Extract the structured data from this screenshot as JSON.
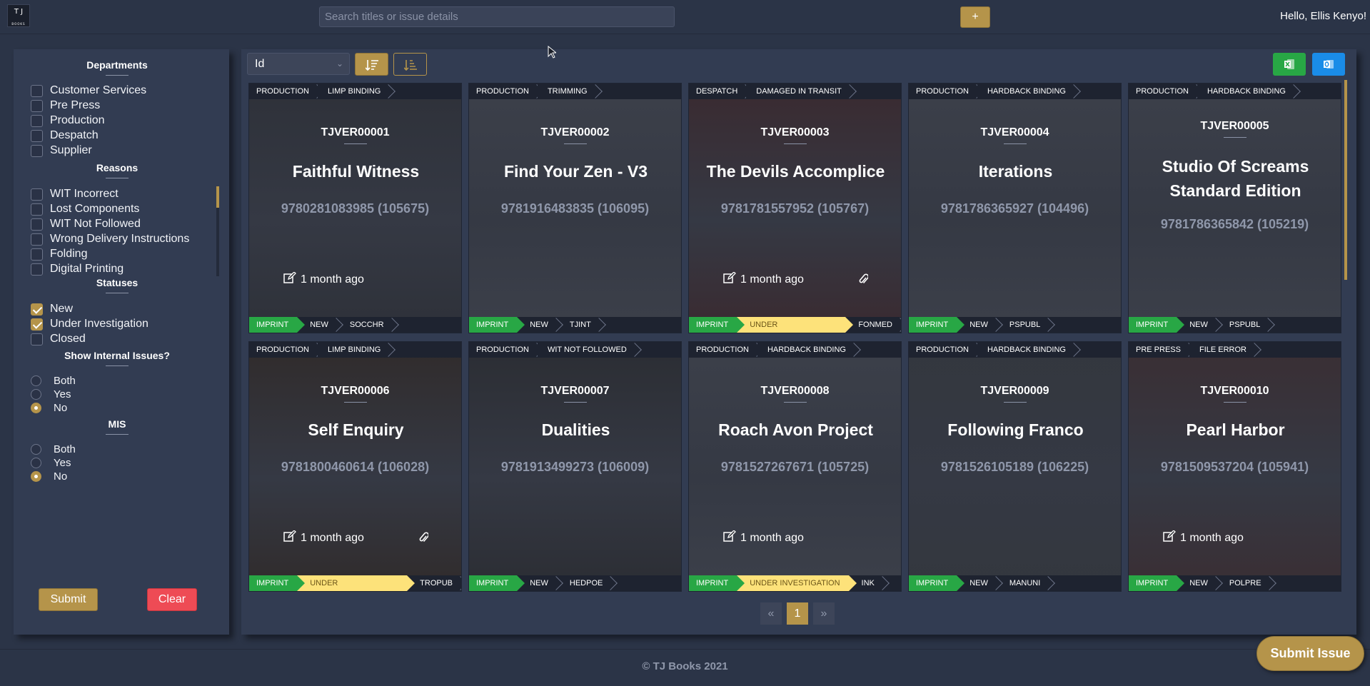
{
  "header": {
    "logo_line1": "T J",
    "logo_line2": "BOOKS",
    "search_placeholder": "Search titles or issue details",
    "add_label": "+",
    "greeting": "Hello, Ellis Kenyo!"
  },
  "filters": {
    "departments_title": "Departments",
    "departments": [
      {
        "label": "Customer Services",
        "checked": false
      },
      {
        "label": "Pre Press",
        "checked": false
      },
      {
        "label": "Production",
        "checked": false
      },
      {
        "label": "Despatch",
        "checked": false
      },
      {
        "label": "Supplier",
        "checked": false
      }
    ],
    "reasons_title": "Reasons",
    "reasons": [
      {
        "label": "WIT Incorrect",
        "checked": false
      },
      {
        "label": "Lost Components",
        "checked": false
      },
      {
        "label": "WIT Not Followed",
        "checked": false
      },
      {
        "label": "Wrong Delivery Instructions",
        "checked": false
      },
      {
        "label": "Folding",
        "checked": false
      },
      {
        "label": "Digital Printing",
        "checked": false
      }
    ],
    "statuses_title": "Statuses",
    "statuses": [
      {
        "label": "New",
        "checked": true
      },
      {
        "label": "Under Investigation",
        "checked": true
      },
      {
        "label": "Closed",
        "checked": false
      }
    ],
    "internal_title": "Show Internal Issues?",
    "internal_options": [
      {
        "label": "Both",
        "selected": false
      },
      {
        "label": "Yes",
        "selected": false
      },
      {
        "label": "No",
        "selected": true
      }
    ],
    "mis_title": "MIS",
    "mis_options": [
      {
        "label": "Both",
        "selected": false
      },
      {
        "label": "Yes",
        "selected": false
      },
      {
        "label": "No",
        "selected": true
      }
    ],
    "submit_label": "Submit",
    "clear_label": "Clear"
  },
  "toolbar": {
    "sort_field": "Id",
    "sort_ascending": true
  },
  "issues": [
    {
      "dept": "PRODUCTION",
      "reason": "LIMP BINDING",
      "ref": "TJVER00001",
      "title": "Faithful Witness",
      "isbn": "9780281083985 (105675)",
      "ago": "1 month ago",
      "attachment": false,
      "imprint": "IMPRINT",
      "status": "NEW",
      "code": "SOCCHR",
      "bg": "#2e3139"
    },
    {
      "dept": "PRODUCTION",
      "reason": "TRIMMING",
      "ref": "TJVER00002",
      "title": "Find Your Zen - V3",
      "isbn": "9781916483835 (106095)",
      "ago": "",
      "attachment": false,
      "imprint": "IMPRINT",
      "status": "NEW",
      "code": "TJINT",
      "bg": "#3c404a"
    },
    {
      "dept": "DESPATCH",
      "reason": "DAMAGED IN TRANSIT",
      "ref": "TJVER00003",
      "title": "The Devils Accomplice",
      "isbn": "9781781557952 (105767)",
      "ago": "1 month ago",
      "attachment": true,
      "imprint": "IMPRINT",
      "status": "UNDER INVESTIGATION",
      "code": "FONMED",
      "bg": "#3a2a30"
    },
    {
      "dept": "PRODUCTION",
      "reason": "HARDBACK BINDING",
      "ref": "TJVER00004",
      "title": "Iterations",
      "isbn": "9781786365927 (104496)",
      "ago": "",
      "attachment": false,
      "imprint": "IMPRINT",
      "status": "NEW",
      "code": "PSPUBL",
      "bg": "#3c404a"
    },
    {
      "dept": "PRODUCTION",
      "reason": "HARDBACK BINDING",
      "ref": "TJVER00005",
      "title": "Studio Of Screams Standard Edition",
      "isbn": "9781786365842 (105219)",
      "ago": "",
      "attachment": false,
      "imprint": "IMPRINT",
      "status": "NEW",
      "code": "PSPUBL",
      "bg": "#3c404a"
    },
    {
      "dept": "PRODUCTION",
      "reason": "LIMP BINDING",
      "ref": "TJVER00006",
      "title": "Self Enquiry",
      "isbn": "9781800460614 (106028)",
      "ago": "1 month ago",
      "attachment": true,
      "imprint": "IMPRINT",
      "status": "UNDER INVESTIGATION",
      "code": "TROPUB",
      "bg": "#302b2b"
    },
    {
      "dept": "PRODUCTION",
      "reason": "WIT NOT FOLLOWED",
      "ref": "TJVER00007",
      "title": "Dualities",
      "isbn": "9781913499273 (106009)",
      "ago": "",
      "attachment": false,
      "imprint": "IMPRINT",
      "status": "NEW",
      "code": "HEDPOE",
      "bg": "#2b2d33"
    },
    {
      "dept": "PRODUCTION",
      "reason": "HARDBACK BINDING",
      "ref": "TJVER00008",
      "title": "Roach Avon Project",
      "isbn": "9781527267671 (105725)",
      "ago": "1 month ago",
      "attachment": false,
      "imprint": "IMPRINT",
      "status": "UNDER INVESTIGATION",
      "code": "INK",
      "bg": "#3c404a"
    },
    {
      "dept": "PRODUCTION",
      "reason": "HARDBACK BINDING",
      "ref": "TJVER00009",
      "title": "Following Franco",
      "isbn": "9781526105189 (106225)",
      "ago": "",
      "attachment": false,
      "imprint": "IMPRINT",
      "status": "NEW",
      "code": "MANUNI",
      "bg": "#33373e"
    },
    {
      "dept": "PRE PRESS",
      "reason": "FILE ERROR",
      "ref": "TJVER00010",
      "title": "Pearl Harbor",
      "isbn": "9781509537204 (105941)",
      "ago": "1 month ago",
      "attachment": false,
      "imprint": "IMPRINT",
      "status": "NEW",
      "code": "POLPRE",
      "bg": "#3a2e33"
    }
  ],
  "pagination": {
    "prev": "«",
    "current": "1",
    "next": "»"
  },
  "footer": {
    "copyright": "© TJ Books 2021"
  },
  "fab": {
    "label": "Submit Issue"
  },
  "colors": {
    "accent": "#b5944a",
    "imprint": "#28a745",
    "under_investigation": "#fde27a",
    "clear": "#ee4b55"
  }
}
